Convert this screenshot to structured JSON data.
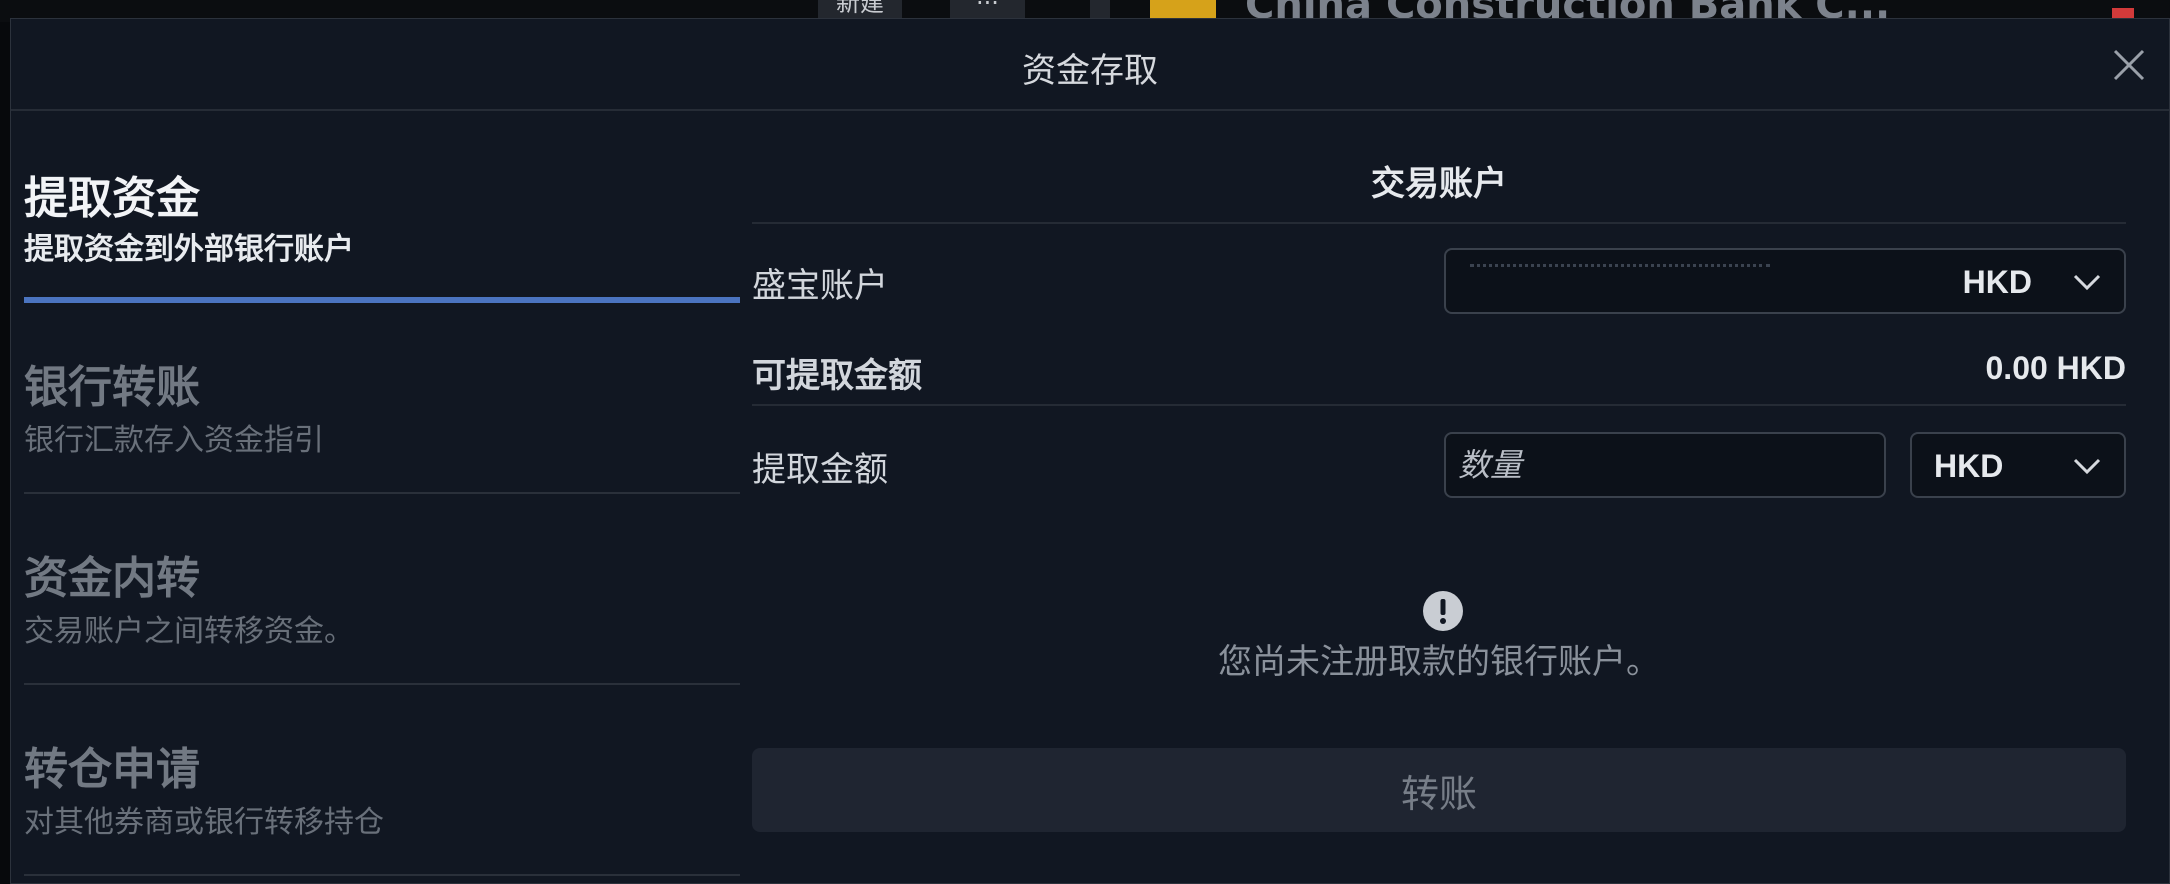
{
  "background": {
    "btn_new": "新建",
    "btn_more": "···",
    "window_title": "China Construction Bank C..."
  },
  "dialog": {
    "title": "资金存取"
  },
  "nav": {
    "items": [
      {
        "title": "提取资金",
        "subtitle": "提取资金到外部银行账户",
        "active": true
      },
      {
        "title": "银行转账",
        "subtitle": "银行汇款存入资金指引",
        "active": false
      },
      {
        "title": "资金内转",
        "subtitle": "交易账户之间转移资金。",
        "active": false
      },
      {
        "title": "转仓申请",
        "subtitle": "对其他券商或银行转移持仓",
        "active": false
      }
    ]
  },
  "panel": {
    "heading": "交易账户",
    "account_label": "盛宝账户",
    "account_currency": "HKD",
    "available_label": "可提取金额",
    "available_value": "0.00 HKD",
    "amount_label": "提取金额",
    "amount_placeholder": "数量",
    "amount_currency": "HKD",
    "notice": "您尚未注册取款的银行账户。",
    "submit_label": "转账"
  },
  "colors": {
    "accent": "#4b74c0",
    "dialog_bg": "#111722"
  }
}
